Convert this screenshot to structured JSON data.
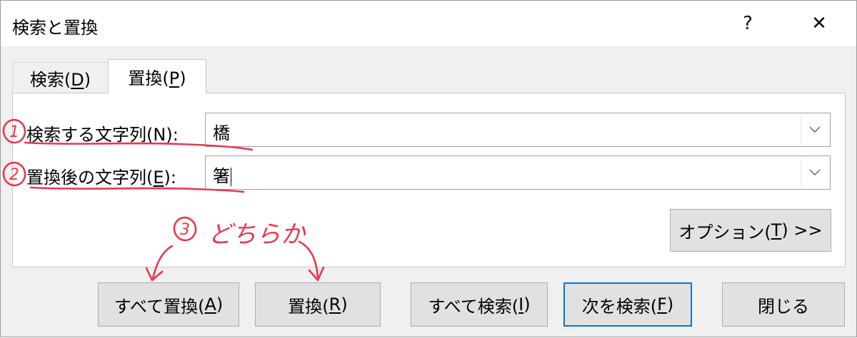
{
  "window": {
    "title": "検索と置換",
    "help_glyph": "?",
    "close_glyph": "✕"
  },
  "tabs": [
    {
      "label": "検索(",
      "mnemonic": "D",
      "suffix": ")"
    },
    {
      "label": "置換(",
      "mnemonic": "P",
      "suffix": ")"
    }
  ],
  "find": {
    "label": "検索する文字列(",
    "mnemonic": "N",
    "suffix": "):",
    "value": "橋"
  },
  "replace": {
    "label": "置換後の文字列(",
    "mnemonic": "E",
    "suffix": "):",
    "value": "箸"
  },
  "buttons": {
    "options": {
      "label": "オプション(",
      "mnemonic": "T",
      "suffix": ") >>"
    },
    "replace_all": {
      "label": "すべて置換(",
      "mnemonic": "A",
      "suffix": ")"
    },
    "replace": {
      "label": "置換(",
      "mnemonic": "R",
      "suffix": ")"
    },
    "find_all": {
      "label": "すべて検索(",
      "mnemonic": "I",
      "suffix": ")"
    },
    "find_next": {
      "label": "次を検索(",
      "mnemonic": "F",
      "suffix": ")"
    },
    "close": {
      "label": "閉じる"
    }
  },
  "annotations": {
    "num1": "1",
    "num2": "2",
    "num3": "3",
    "choice": "どちらか",
    "color": "#e8384f"
  },
  "colors": {
    "default_button_border": "#0078d7",
    "annotation": "#e8384f"
  }
}
